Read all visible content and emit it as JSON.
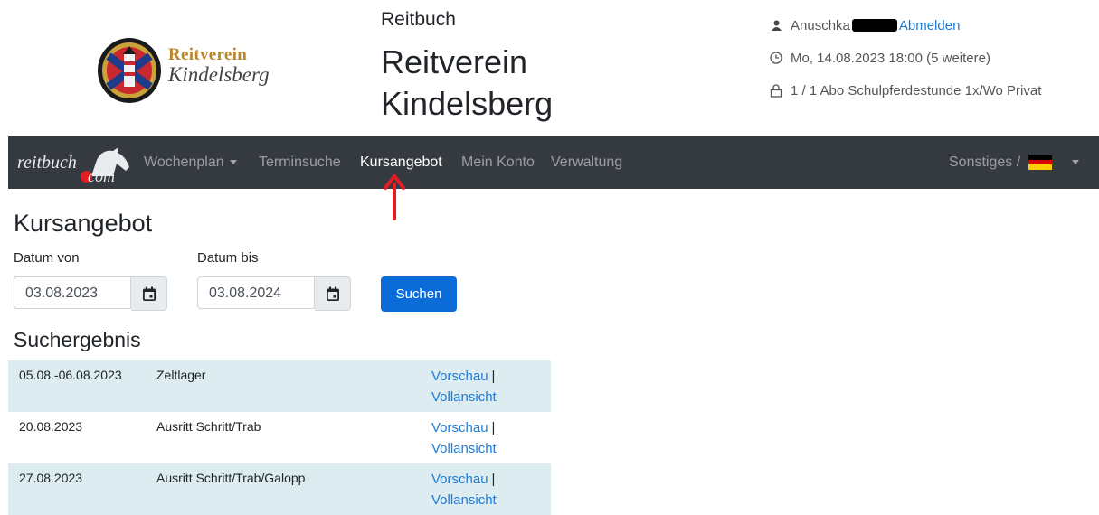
{
  "header": {
    "logo_line1": "Reitverein",
    "logo_line2": "Kindelsberg",
    "app_title": "Reitbuch",
    "club_title": "Reitverein Kindelsberg",
    "user_name": "Anuschka",
    "logout_label": "Abmelden",
    "next_appointment": "Mo, 14.08.2023 18:00 (5 weitere)",
    "subscription": "1 / 1 Abo Schulpferdestunde 1x/Wo Privat"
  },
  "navbar": {
    "brand_part1": "reitbuch",
    "brand_part2": "com",
    "items": [
      {
        "label": "Wochenplan"
      },
      {
        "label": "Terminsuche"
      },
      {
        "label": "Kursangebot"
      },
      {
        "label": "Mein Konto"
      },
      {
        "label": "Verwaltung"
      }
    ],
    "misc_label": "Sonstiges /",
    "active_item": "Kursangebot"
  },
  "page": {
    "title": "Kursangebot",
    "date_from_label": "Datum von",
    "date_from_value": "03.08.2023",
    "date_to_label": "Datum bis",
    "date_to_value": "03.08.2024",
    "search_button": "Suchen",
    "results_title": "Suchergebnis"
  },
  "results": [
    {
      "date": "05.08.-06.08.2023",
      "title": "Zeltlager",
      "preview": "Vorschau",
      "separator": "|",
      "full": "Vollansicht"
    },
    {
      "date": "20.08.2023",
      "title": "Ausritt Schritt/Trab",
      "preview": "Vorschau",
      "separator": "|",
      "full": "Vollansicht"
    },
    {
      "date": "27.08.2023",
      "title": "Ausritt Schritt/Trab/Galopp",
      "preview": "Vorschau",
      "separator": "|",
      "full": "Vollansicht"
    }
  ],
  "colors": {
    "navbar_bg": "#343a40",
    "primary_button": "#0b6cd8",
    "link": "#1e7cd6",
    "row_highlight": "#dcecf0",
    "annotation_arrow": "#e21d23"
  }
}
